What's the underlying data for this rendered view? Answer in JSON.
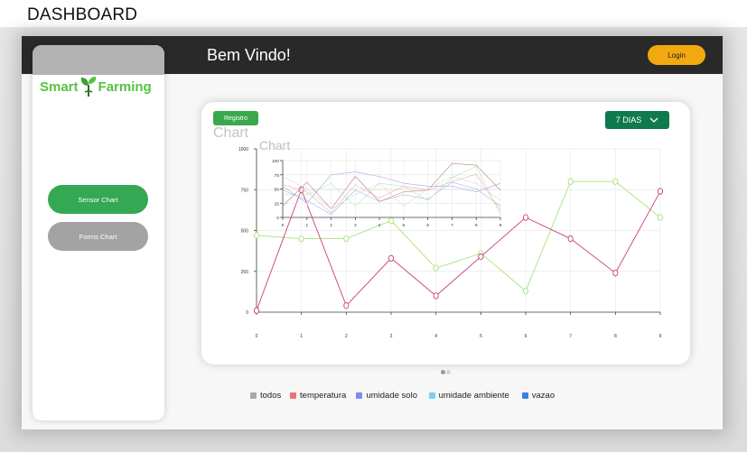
{
  "page_label": "DASHBOARD",
  "header": {
    "welcome": "Bem Vindo!",
    "login_label": "Login"
  },
  "brand": {
    "part1": "Smart",
    "part2": "Farming",
    "color": "#55c341"
  },
  "sidebar": {
    "items": [
      {
        "label": "Sensor Chart",
        "active": true
      },
      {
        "label": "Forms Chart",
        "active": false
      }
    ]
  },
  "card": {
    "registro_label": "Registro",
    "range_label": "7 DIAS"
  },
  "legend": [
    {
      "label": "todos",
      "color": "#a8a8a8"
    },
    {
      "label": "temperatura",
      "color": "#f07070"
    },
    {
      "label": "umidade solo",
      "color": "#7b8cf2"
    },
    {
      "label": "umidade ambiente",
      "color": "#78d2f0"
    },
    {
      "label": "vazao",
      "color": "#3b7fe0"
    }
  ],
  "chart_data": [
    {
      "type": "line",
      "title": "Chart",
      "x": [
        0,
        1,
        2,
        3,
        4,
        5,
        6,
        7,
        8,
        9
      ],
      "yticks": [
        0,
        250,
        500,
        750,
        1000
      ],
      "ylim": [
        0,
        1000
      ],
      "grid": true,
      "series": [
        {
          "values": [
            470,
            450,
            450,
            560,
            270,
            360,
            130,
            800,
            800,
            580
          ],
          "color": "#a6e37c"
        },
        {
          "values": [
            10,
            750,
            40,
            330,
            100,
            340,
            580,
            450,
            240,
            740
          ],
          "color": "#cc3d7a"
        }
      ]
    },
    {
      "type": "line",
      "title": "Chart",
      "x": [
        0,
        1,
        2,
        3,
        4,
        5,
        6,
        7,
        8,
        9
      ],
      "yticks": [
        0,
        25,
        50,
        75,
        100
      ],
      "ylim": [
        0,
        100
      ],
      "grid": true,
      "series": [
        {
          "values": [
            48,
            30,
            5,
            48,
            28,
            40,
            32,
            62,
            50,
            20
          ],
          "color": "#9fb4ea"
        },
        {
          "values": [
            58,
            45,
            8,
            58,
            34,
            55,
            48,
            63,
            76,
            12
          ],
          "color": "#f2b0b0"
        },
        {
          "values": [
            40,
            40,
            60,
            20,
            60,
            55,
            30,
            70,
            90,
            5
          ],
          "color": "#b8e8ae"
        },
        {
          "values": [
            55,
            25,
            75,
            80,
            72,
            60,
            55,
            55,
            45,
            60
          ],
          "color": "#a9a9e0"
        },
        {
          "values": [
            20,
            62,
            15,
            72,
            28,
            45,
            48,
            95,
            92,
            48
          ],
          "color": "#c07f7f"
        },
        {
          "values": [
            72,
            50,
            15,
            40,
            60,
            20,
            50,
            72,
            60,
            30
          ],
          "color": "#d9d9d9"
        }
      ]
    }
  ]
}
